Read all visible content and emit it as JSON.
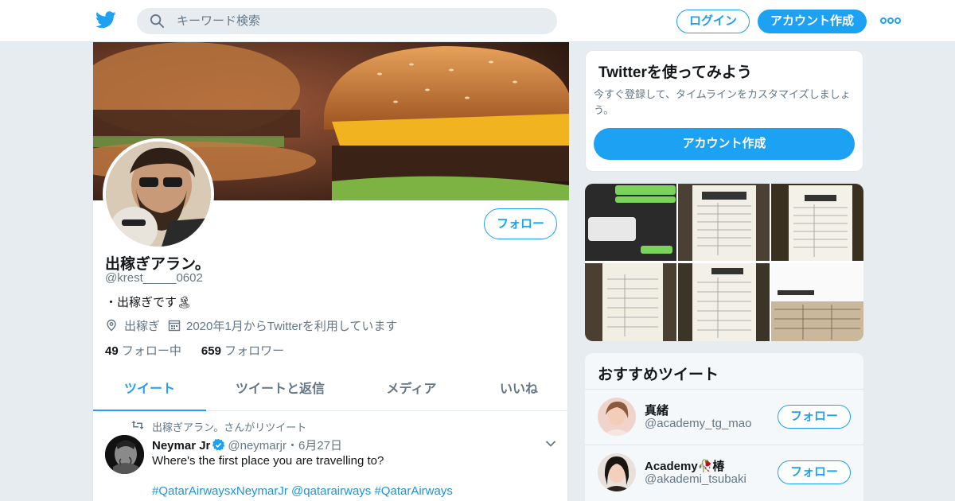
{
  "topbar": {
    "search_placeholder": "キーワード検索",
    "login_label": "ログイン",
    "signup_label": "アカウント作成"
  },
  "profile": {
    "display_name": "出稼ぎアラン。",
    "handle": "@krest_____0602",
    "bio": "・出稼ぎです🏝",
    "location": "出稼ぎ",
    "joined": "2020年1月からTwitterを利用しています",
    "following_count": "49",
    "following_label": "フォロー中",
    "followers_count": "659",
    "followers_label": "フォロワー",
    "follow_label": "フォロー"
  },
  "tabs": [
    {
      "label": "ツイート",
      "active": true
    },
    {
      "label": "ツイートと返信",
      "active": false
    },
    {
      "label": "メディア",
      "active": false
    },
    {
      "label": "いいね",
      "active": false
    }
  ],
  "tweet": {
    "retweet_context": "出稼ぎアラン。さんがリツイート",
    "author_name": "Neymar Jr",
    "author_handle": "@neymarjr",
    "separator": "・",
    "date": "6月27日",
    "text": "Where's the first place you are travelling to?",
    "tags": "#QatarAirwaysxNeymarJr @qatarairways #QatarAirways"
  },
  "try_card": {
    "title": "Twitterを使ってみよう",
    "description": "今すぐ登録して、タイムラインをカスタマイズしましょう。",
    "button_label": "アカウント作成"
  },
  "recommendations": {
    "title": "おすすめツイート",
    "items": [
      {
        "name": "真緒",
        "handle": "@academy_tg_mao",
        "button_label": "フォロー"
      },
      {
        "name": "Academy🥀椿",
        "handle": "@akademi_tsubaki",
        "button_label": "フォロー"
      }
    ]
  },
  "colors": {
    "accent": "#1da1f2",
    "link": "#1b95e0",
    "muted": "#657786",
    "background": "#e6ecf0"
  }
}
